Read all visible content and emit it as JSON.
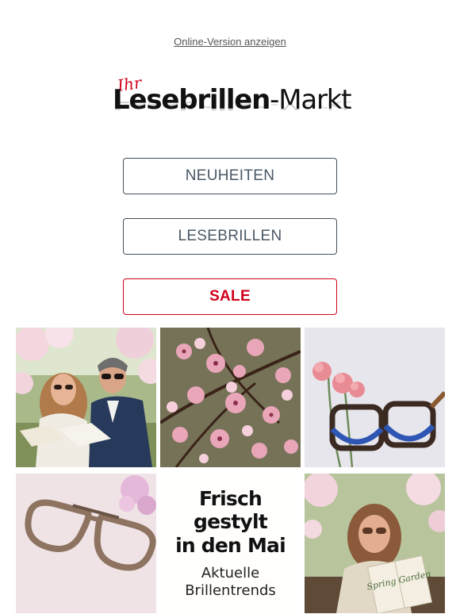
{
  "header": {
    "online_version_link": "Online-Version anzeigen"
  },
  "logo": {
    "prefix": "Ihr",
    "word1": "Lesebrillen",
    "word2": "-Markt"
  },
  "nav": {
    "items": [
      {
        "label": "NEUHEITEN"
      },
      {
        "label": "LESEBRILLEN"
      },
      {
        "label": "SALE"
      }
    ]
  },
  "promo": {
    "headline_line1": "Frisch gestylt",
    "headline_line2": "in den Mai",
    "sub_line1": "Aktuelle",
    "sub_line2": "Brillentrends"
  },
  "images": {
    "couple": "couple-reading-under-blossoms",
    "blossoms": "pink-cherry-blossoms",
    "carnation_glasses": "carnation-and-tortoise-blue-glasses",
    "aviator_glasses": "tortoise-aviator-glasses",
    "book": "Spring Garden",
    "woman": "woman-reading-book"
  },
  "colors": {
    "accent_red": "#d0021b",
    "button_border": "#44505c",
    "button_text": "#4a5866"
  }
}
